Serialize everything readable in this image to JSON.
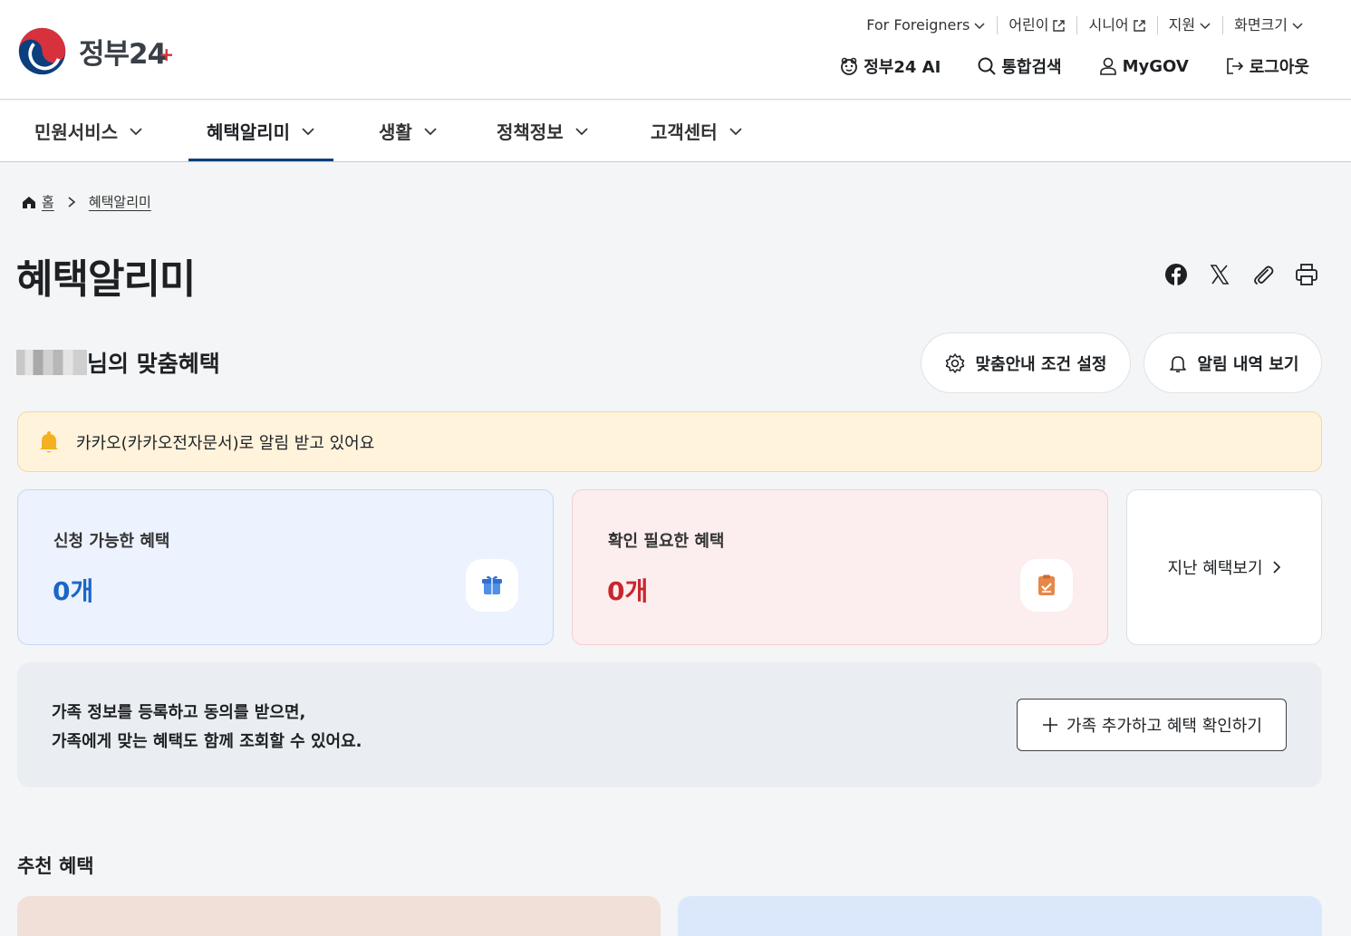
{
  "header": {
    "logo_text": "정부24",
    "util_nav": [
      {
        "label": "For Foreigners",
        "icon": "chevron-down-icon"
      },
      {
        "label": "어린이",
        "icon": "external-link-icon"
      },
      {
        "label": "시니어",
        "icon": "external-link-icon"
      },
      {
        "label": "지원",
        "icon": "chevron-down-icon"
      },
      {
        "label": "화면크기",
        "icon": "chevron-down-icon"
      }
    ],
    "main_util": [
      {
        "label": "정부24 AI",
        "icon": "ai-character-icon"
      },
      {
        "label": "통합검색",
        "icon": "search-icon"
      },
      {
        "label": "MyGOV",
        "icon": "user-icon"
      },
      {
        "label": "로그아웃",
        "icon": "logout-icon"
      }
    ]
  },
  "gnb": {
    "items": [
      "민원서비스",
      "혜택알리미",
      "생활",
      "정책정보",
      "고객센터"
    ],
    "active": "혜택알리미"
  },
  "breadcrumb": {
    "home": "홈",
    "current": "혜택알리미"
  },
  "page_title": "혜택알리미",
  "section": {
    "title_suffix": "님의 맞춤혜택",
    "settings_button": "맞춤안내 조건 설정",
    "alerts_button": "알림 내역 보기"
  },
  "notice": {
    "text": "카카오(카카오전자문서)로 알림 받고 있어요"
  },
  "cards": {
    "available": {
      "label": "신청 가능한 혜택",
      "count": "0개"
    },
    "check": {
      "label": "확인 필요한 혜택",
      "count": "0개"
    },
    "past": {
      "label": "지난 혜택보기"
    }
  },
  "family": {
    "line1": "가족 정보를 등록하고 동의를 받으면,",
    "line2": "가족에게 맞는 혜택도 함께 조회할 수 있어요.",
    "button": "가족 추가하고 혜택 확인하기"
  },
  "recommend": {
    "title": "추천 혜택"
  },
  "colors": {
    "accent": "#0b3f7d",
    "blue": "#1a66c9",
    "red": "#c8252f",
    "notice_bg": "#fff3dc"
  }
}
